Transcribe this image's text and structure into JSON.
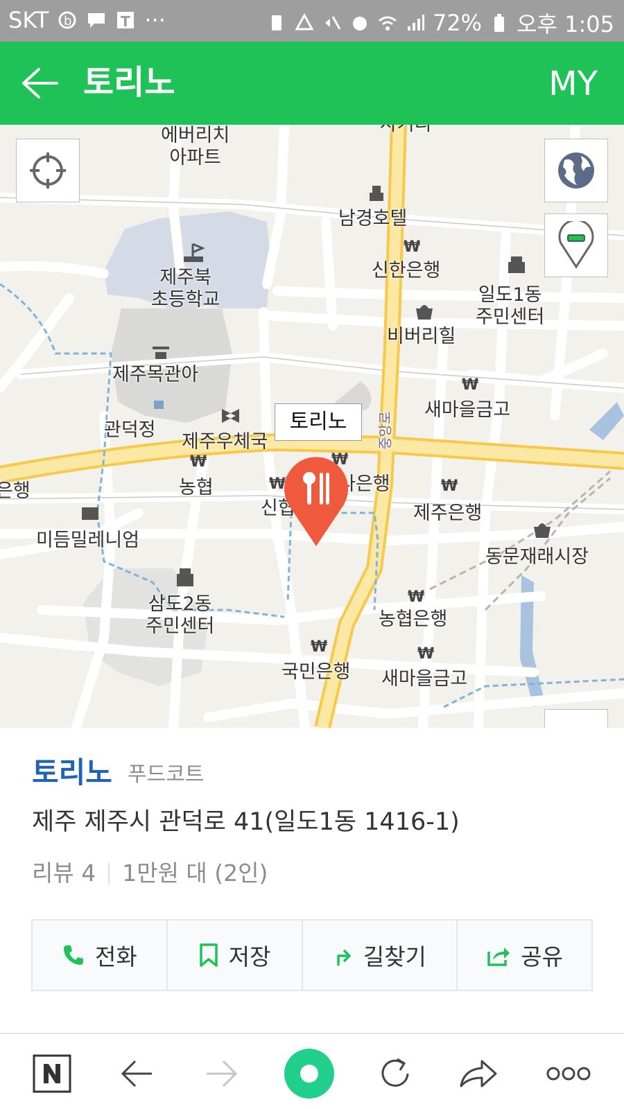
{
  "status_bar": {
    "carrier": "SKT",
    "battery": "72%",
    "time": "오후 1:05"
  },
  "app_bar": {
    "title": "토리노",
    "my_label": "MY"
  },
  "map": {
    "callout": "토리노",
    "labels": {
      "everich": "에버리치\n아파트",
      "namgyeong": "남경호텔",
      "shinhan": "신한은행",
      "jejubuk": "제주북\n초등학교",
      "ildo_center": "일도1동\n주민센터",
      "beverly": "비버리힐",
      "mokgwana": "제주목관아",
      "saemaeul1": "새마을금고",
      "gwandeok": "관덕정",
      "post": "제주우체국",
      "nonghyup": "농협",
      "keb": "KEB하나은행",
      "sinhyup": "신협",
      "bank_left": "은행",
      "jejubank": "제주은행",
      "midum": "미듬밀레니엄",
      "dongmun": "동문재래시장",
      "samdo": "삼도2동\n주민센터",
      "nhbank": "농협은행",
      "kookmin": "국민은행",
      "saemaeul2": "새마을금고",
      "road_jungang": "중앙로",
      "road_top": "사거리"
    }
  },
  "place": {
    "name": "토리노",
    "category": "푸드코트",
    "address": "제주 제주시 관덕로 41(일도1동 1416-1)",
    "reviews": "리뷰 4",
    "price": "1만원 대 (2인)"
  },
  "actions": {
    "call": "전화",
    "save": "저장",
    "directions": "길찾기",
    "share": "공유"
  },
  "colors": {
    "brand_green": "#1ec257",
    "place_blue": "#1e63b6",
    "pin_red": "#f05a3c",
    "main_road": "#f7c948"
  },
  "icons": {
    "back": "arrow-left-icon",
    "locate": "crosshair-icon",
    "globe": "globe-icon",
    "marker_toggle": "map-pin-icon",
    "zoom_in": "plus-icon",
    "zoom_out": "minus-icon",
    "call": "phone-icon",
    "save": "bookmark-icon",
    "directions": "turn-arrow-icon",
    "share": "share-icon"
  }
}
